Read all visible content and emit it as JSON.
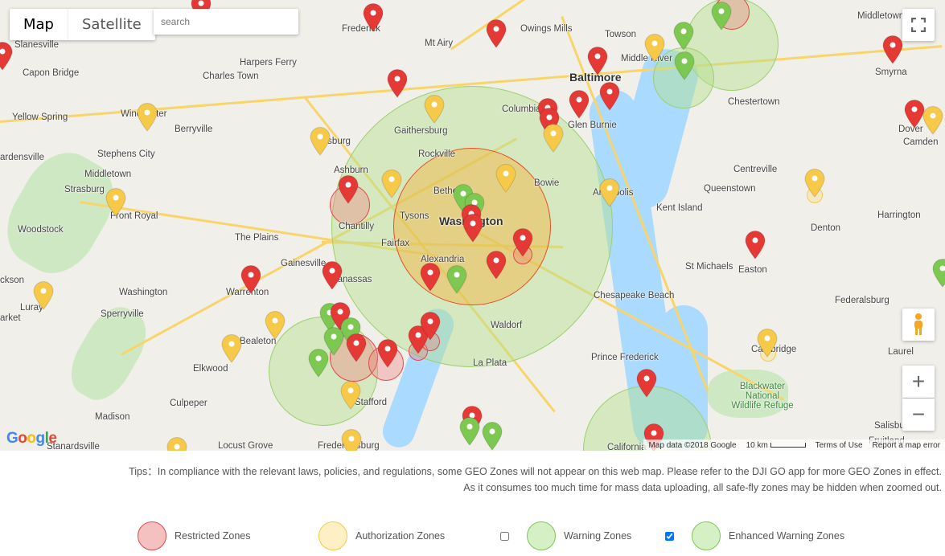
{
  "map_type": {
    "map": "Map",
    "satellite": "Satellite",
    "active": "Map"
  },
  "search": {
    "placeholder": "search",
    "value": ""
  },
  "places": [
    "Frederick",
    "Mt Airy",
    "Owings Mills",
    "Towson",
    "Baltimore",
    "Columbia",
    "Glen Burnie",
    "Middle River",
    "Gaithersburg",
    "Rockville",
    "Bethesda",
    "Tysons",
    "Washington",
    "Fairfax",
    "Alexandria",
    "Bowie",
    "Annapolis",
    "Chantilly",
    "Ashburn",
    "Leesburg",
    "Manassas",
    "Gainesville",
    "The Plains",
    "Warrenton",
    "Washington",
    "Sperryville",
    "Luray",
    "Front Royal",
    "Strasburg",
    "Woodstock",
    "Middletown",
    "Stephens City",
    "Winchester",
    "Berryville",
    "Charles Town",
    "Harpers Ferry",
    "Capon Bridge",
    "Slanesville",
    "Yellow Spring",
    "Bealeton",
    "Elkwood",
    "Culpeper",
    "Madison",
    "Stafford",
    "Locust Grove",
    "Fredericksburg",
    "Stanardsville",
    "Waldorf",
    "La Plata",
    "Chesapeake Beach",
    "Prince Frederick",
    "California",
    "Kent Island",
    "Queenstown",
    "Centreville",
    "Chestertown",
    "St Michaels",
    "Easton",
    "Cambridge",
    "Denton",
    "Harrington",
    "Federalsburg",
    "Middletown",
    "Smyrna",
    "Dover",
    "Camden",
    "Laurel",
    "Salisbury",
    "Fruitland",
    "Blackwater National Wildlife Refuge",
    "ardensville",
    "ckson",
    "arket"
  ],
  "attribution": {
    "map_data": "Map data ©2018 Google",
    "scale": "10 km",
    "terms": "Terms of Use",
    "report": "Report a map error"
  },
  "logo": "Google",
  "tips": {
    "line1": "Tips：In compliance with the relevant laws, policies, and regulations, some GEO Zones will not appear on this web map. Please refer to the DJI GO app for more GEO Zones in effect.",
    "line2": "As it consumes too much time for mass data uploading, all safe-fly zones may be hidden when zoomed out."
  },
  "legend": [
    {
      "label": "Restricted Zones",
      "fill": "#f5c0c0",
      "stroke": "#e04848"
    },
    {
      "label": "Authorization Zones",
      "fill": "#fdf0c4",
      "stroke": "#f7c948"
    },
    {
      "label": "Warning Zones",
      "fill": "#d4f0c4",
      "stroke": "#7cc850",
      "checked": false
    },
    {
      "label": "Enhanced Warning Zones",
      "fill": "#d4f0c4",
      "stroke": "#7cc850",
      "checked": true
    }
  ],
  "colors": {
    "restricted": "#e53935",
    "authorization": "#f7c948",
    "warning": "#7cc850"
  },
  "icons": {
    "fullscreen": "fullscreen-icon",
    "pegman": "street-view-icon",
    "zoom_in": "plus-icon",
    "zoom_out": "minus-icon"
  }
}
